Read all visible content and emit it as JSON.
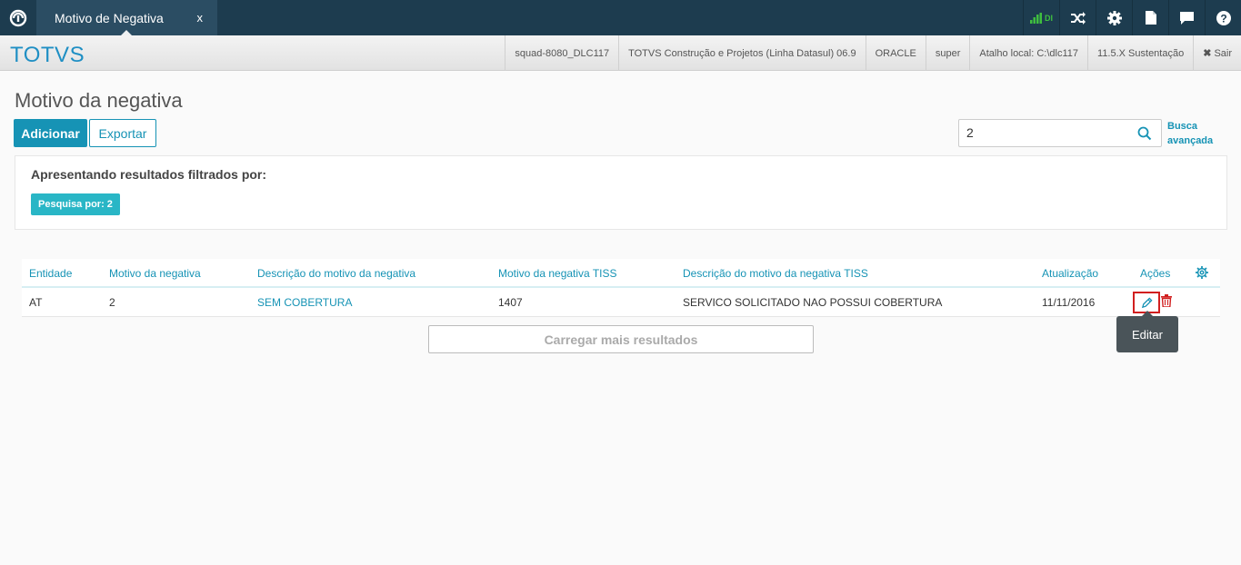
{
  "topbar": {
    "tab_title": "Motivo de Negativa",
    "tab_close": "x",
    "signal_label": "DI",
    "icons": [
      "totvs-logo-icon",
      "signal-icon",
      "shuffle-icon",
      "gear-icon",
      "document-icon",
      "chat-icon",
      "help-icon"
    ]
  },
  "header": {
    "brand": "TOTVS",
    "info": [
      "squad-8080_DLC117",
      "TOTVS Construção e Projetos (Linha Datasul) 06.9",
      "ORACLE",
      "super",
      "Atalho local: C:\\dlc117",
      "11.5.X Sustentação"
    ],
    "logout_label": "Sair"
  },
  "page": {
    "title": "Motivo da negativa",
    "add_label": "Adicionar",
    "export_label": "Exportar",
    "search_value": "2",
    "advanced_search_line1": "Busca",
    "advanced_search_line2": "avançada"
  },
  "filter": {
    "title": "Apresentando resultados filtrados por:",
    "tag": "Pesquisa por: 2"
  },
  "table": {
    "columns": [
      "Entidade",
      "Motivo da negativa",
      "Descrição do motivo da negativa",
      "Motivo da negativa TISS",
      "Descrição do motivo da negativa TISS",
      "Atualização",
      "Ações"
    ],
    "rows": [
      [
        "AT",
        "2",
        "SEM COBERTURA",
        "1407",
        "SERVICO SOLICITADO NAO POSSUI COBERTURA",
        "11/11/2016"
      ]
    ]
  },
  "tooltip": "Editar",
  "load_more_label": "Carregar mais resultados",
  "colors": {
    "topbar": "#1d3c4f",
    "accent": "#1693b5",
    "tag": "#29b6c6",
    "delete": "#d11f1f"
  }
}
